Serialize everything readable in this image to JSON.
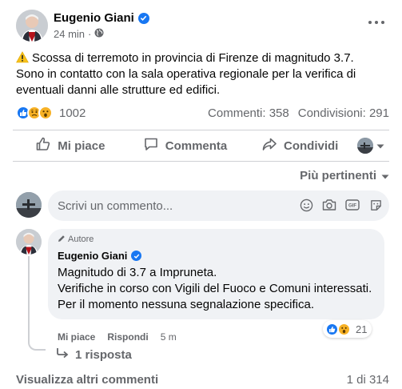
{
  "post": {
    "author": "Eugenio Giani",
    "time": "24 min",
    "text": "Scossa di terremoto in provincia di Firenze di magnitudo 3.7. Sono in contatto con la sala operativa regionale per la verifica di eventuali danni alle strutture ed edifici.",
    "reaction_count": "1002",
    "comments": "Commenti: 358",
    "shares": "Condivisioni: 291"
  },
  "actions": {
    "like": "Mi piace",
    "comment": "Commenta",
    "share": "Condividi"
  },
  "sort": {
    "label": "Più pertinenti"
  },
  "comment_box": {
    "placeholder": "Scrivi un commento..."
  },
  "reply": {
    "author_tag": "Autore",
    "author": "Eugenio Giani",
    "line1": "Magnitudo di 3.7 a Impruneta.",
    "line2": "Verifiche in corso con Vigili del Fuoco e Comuni interessati.",
    "line3": "Per il momento nessuna segnalazione specifica.",
    "like": "Mi piace",
    "reply": "Rispondi",
    "time": "5 m",
    "reaction_count": "21",
    "replies": "1 risposta"
  },
  "footer": {
    "more_comments": "Visualizza altri commenti",
    "pager": "1 di 314"
  },
  "colors": {
    "brand_blue": "#1877f2",
    "secondary_text": "#65676b",
    "bubble_bg": "#f0f2f5",
    "divider": "#ced0d4"
  },
  "icons": [
    "verified-badge-icon",
    "globe-icon",
    "more-icon",
    "warning-icon",
    "like-reaction-icon",
    "sad-reaction-icon",
    "wow-reaction-icon",
    "thumbs-up-icon",
    "comment-icon",
    "share-icon",
    "chevron-down-icon",
    "emoji-icon",
    "camera-icon",
    "gif-icon",
    "sticker-icon",
    "pencil-icon",
    "reply-arrow-icon"
  ]
}
